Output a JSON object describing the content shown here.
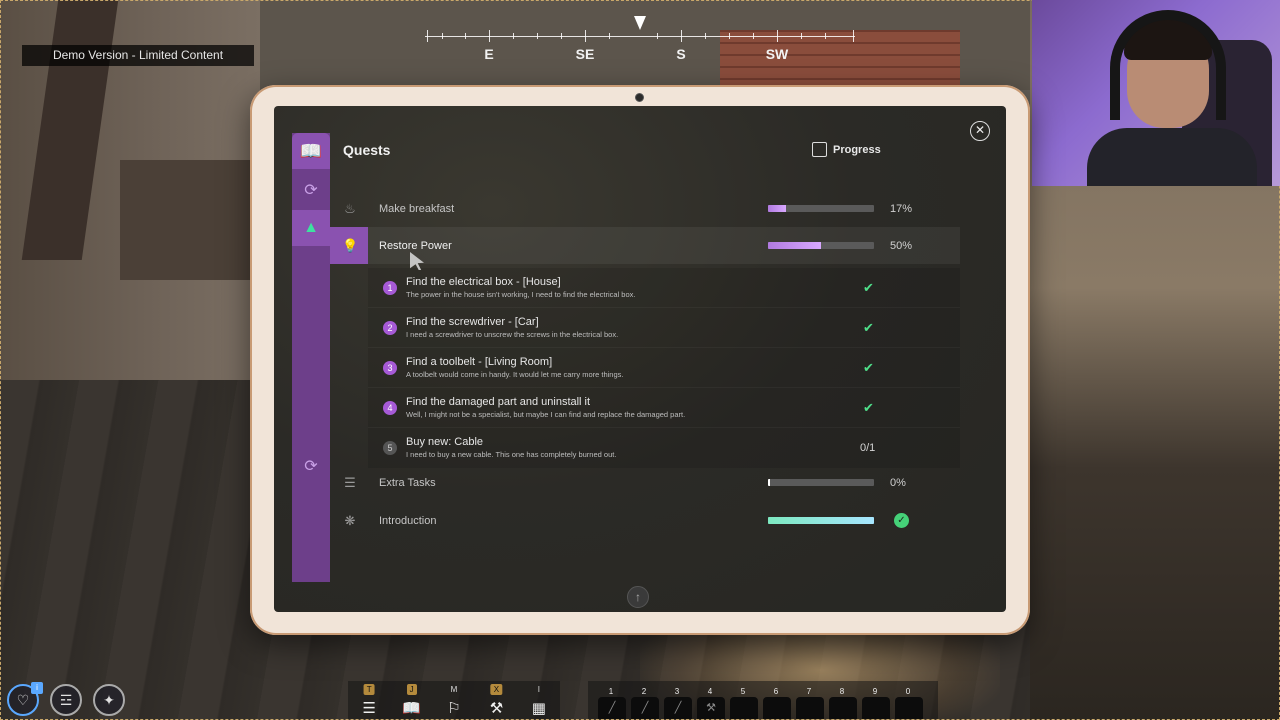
{
  "hud": {
    "demo_badge": "Demo Version - Limited Content",
    "compass": [
      "E",
      "SE",
      "S",
      "SW"
    ]
  },
  "quests": {
    "title": "Quests",
    "progress_header": "Progress",
    "list": [
      {
        "label": "Make breakfast",
        "icon": "chef-hat-icon",
        "progress": 0.17,
        "pct": "17%"
      },
      {
        "label": "Restore Power",
        "icon": "lightbulb-icon",
        "progress": 0.5,
        "pct": "50%"
      },
      {
        "label": "Extra Tasks",
        "icon": "bed-icon",
        "progress": 0.0,
        "pct": "0%"
      },
      {
        "label": "Introduction",
        "icon": "footprints-icon",
        "progress": 1.0,
        "pct": ""
      }
    ],
    "tasks": [
      {
        "num": "1",
        "name": "Find the electrical box - [House]",
        "desc": "The power in the house isn't working, I need to find the electrical box.",
        "done": true
      },
      {
        "num": "2",
        "name": "Find the screwdriver - [Car]",
        "desc": "I need a screwdriver to unscrew the screws in the electrical box.",
        "done": true
      },
      {
        "num": "3",
        "name": "Find a toolbelt - [Living Room]",
        "desc": "A toolbelt would come in handy. It would let me carry more things.",
        "done": true
      },
      {
        "num": "4",
        "name": "Find the damaged part and uninstall it",
        "desc": "Well, I might not be a specialist, but maybe I can find and replace the damaged part.",
        "done": true
      },
      {
        "num": "5",
        "name": "Buy new: Cable",
        "desc": "I need to buy a new cable. This one has completely burned out.",
        "done": false,
        "count": "0/1"
      }
    ]
  },
  "menu": {
    "keys": [
      "T",
      "J",
      "M",
      "X",
      "I"
    ]
  },
  "hotbar": {
    "keys": [
      "1",
      "2",
      "3",
      "4",
      "5",
      "6",
      "7",
      "8",
      "9",
      "0"
    ]
  },
  "colors": {
    "accent_purple": "#8a52b0",
    "check_green": "#4fe08a"
  }
}
